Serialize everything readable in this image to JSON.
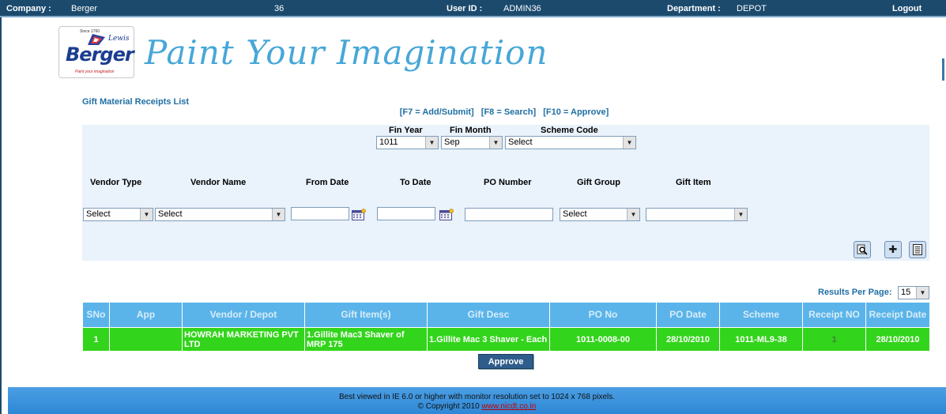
{
  "header": {
    "company_label": "Company :",
    "company_value": "Berger",
    "code": "36",
    "userid_label": "User ID :",
    "userid_value": "ADMIN36",
    "department_label": "Department :",
    "department_value": "DEPOT",
    "logout_label": "Logout"
  },
  "logo": {
    "since": "Since 1760",
    "lewis": "Lewis",
    "brand": "Berger",
    "tag": "Paint your imagination"
  },
  "tagline": "Paint Your Imagination",
  "page_title": "Gift Material Receipts List",
  "shortcuts": [
    "[F7 = Add/Submit]",
    "[F8 = Search]",
    "[F10 = Approve]"
  ],
  "filters": {
    "fin_year": {
      "label": "Fin Year",
      "value": "1011"
    },
    "fin_month": {
      "label": "Fin Month",
      "value": "Sep"
    },
    "scheme_code": {
      "label": "Scheme Code",
      "value": "Select"
    },
    "vendor_type": {
      "label": "Vendor Type",
      "value": "Select"
    },
    "vendor_name": {
      "label": "Vendor Name",
      "value": "Select"
    },
    "from_date": {
      "label": "From Date",
      "value": ""
    },
    "to_date": {
      "label": "To Date",
      "value": ""
    },
    "po_number": {
      "label": "PO Number",
      "value": ""
    },
    "gift_group": {
      "label": "Gift Group",
      "value": "Select"
    },
    "gift_item": {
      "label": "Gift Item",
      "value": ""
    }
  },
  "results_per_page": {
    "label": "Results Per Page:",
    "value": "15"
  },
  "table": {
    "columns": [
      "SNo",
      "App",
      "Vendor / Depot",
      "Gift Item(s)",
      "Gift Desc",
      "PO No",
      "PO Date",
      "Scheme",
      "Receipt NO",
      "Receipt Date"
    ],
    "rows": [
      {
        "sno": "1",
        "app": "",
        "vendor": "HOWRAH MARKETING PVT LTD",
        "gift_items": "1.Gillite Mac3 Shaver of MRP 175",
        "gift_desc": "1.Gillite Mac 3 Shaver - Each",
        "po_no": "1011-0008-00",
        "po_date": "28/10/2010",
        "scheme": "1011-ML9-38",
        "receipt_no": "1",
        "receipt_date": "28/10/2010"
      }
    ]
  },
  "approve_label": "Approve",
  "footer": {
    "line1": "Best viewed in IE 6.0 or higher with monitor resolution set to 1024 x 768 pixels.",
    "copyright": "© Copyright 2010",
    "link": "www.nicdt.co.in"
  },
  "colors": {
    "topbar": "#1b4a6d",
    "header_row": "#5ab4ea",
    "data_row": "#33d41c",
    "accent_text": "#1f6fa3",
    "tagline": "#47a7d8"
  }
}
